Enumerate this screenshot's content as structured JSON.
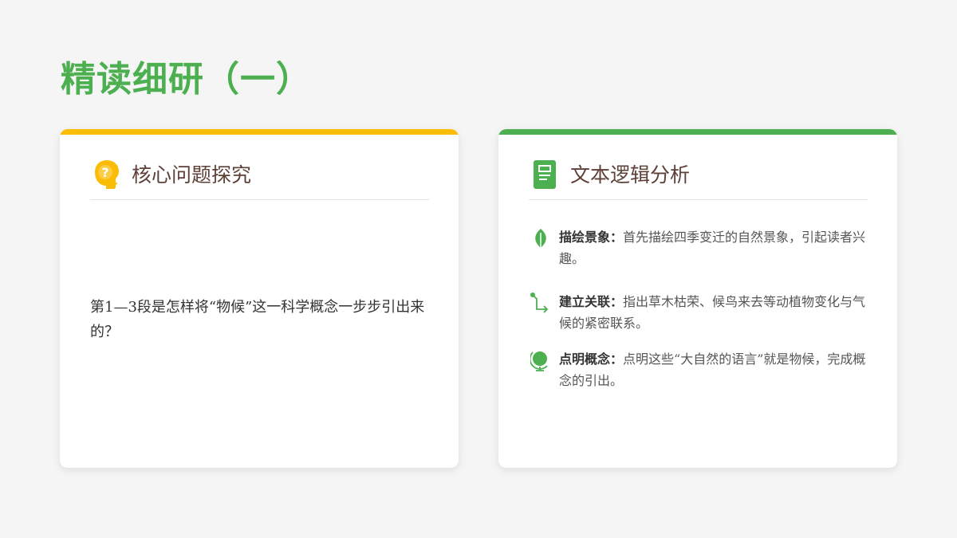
{
  "page": {
    "title": "精读细研（一）"
  },
  "left_card": {
    "title": "核心问题探究",
    "icon": "head-question-icon",
    "accent": "#fbbc05",
    "question": "第1—3段是怎样将“物候”这一科学概念一步步引出来的？"
  },
  "right_card": {
    "title": "文本逻辑分析",
    "icon": "document-icon",
    "accent": "#4caf50",
    "points": [
      {
        "icon": "leaf-icon",
        "label": "描绘景象：",
        "text": "首先描绘四季变迁的自然景象，引起读者兴趣。"
      },
      {
        "icon": "connector-arrow-icon",
        "label": "建立关联：",
        "text": "指出草木枯荣、候鸟来去等动植物变化与气候的紧密联系。"
      },
      {
        "icon": "globe-icon",
        "label": "点明概念：",
        "text": "点明这些“大自然的语言”就是物候，完成概念的引出。"
      }
    ]
  }
}
